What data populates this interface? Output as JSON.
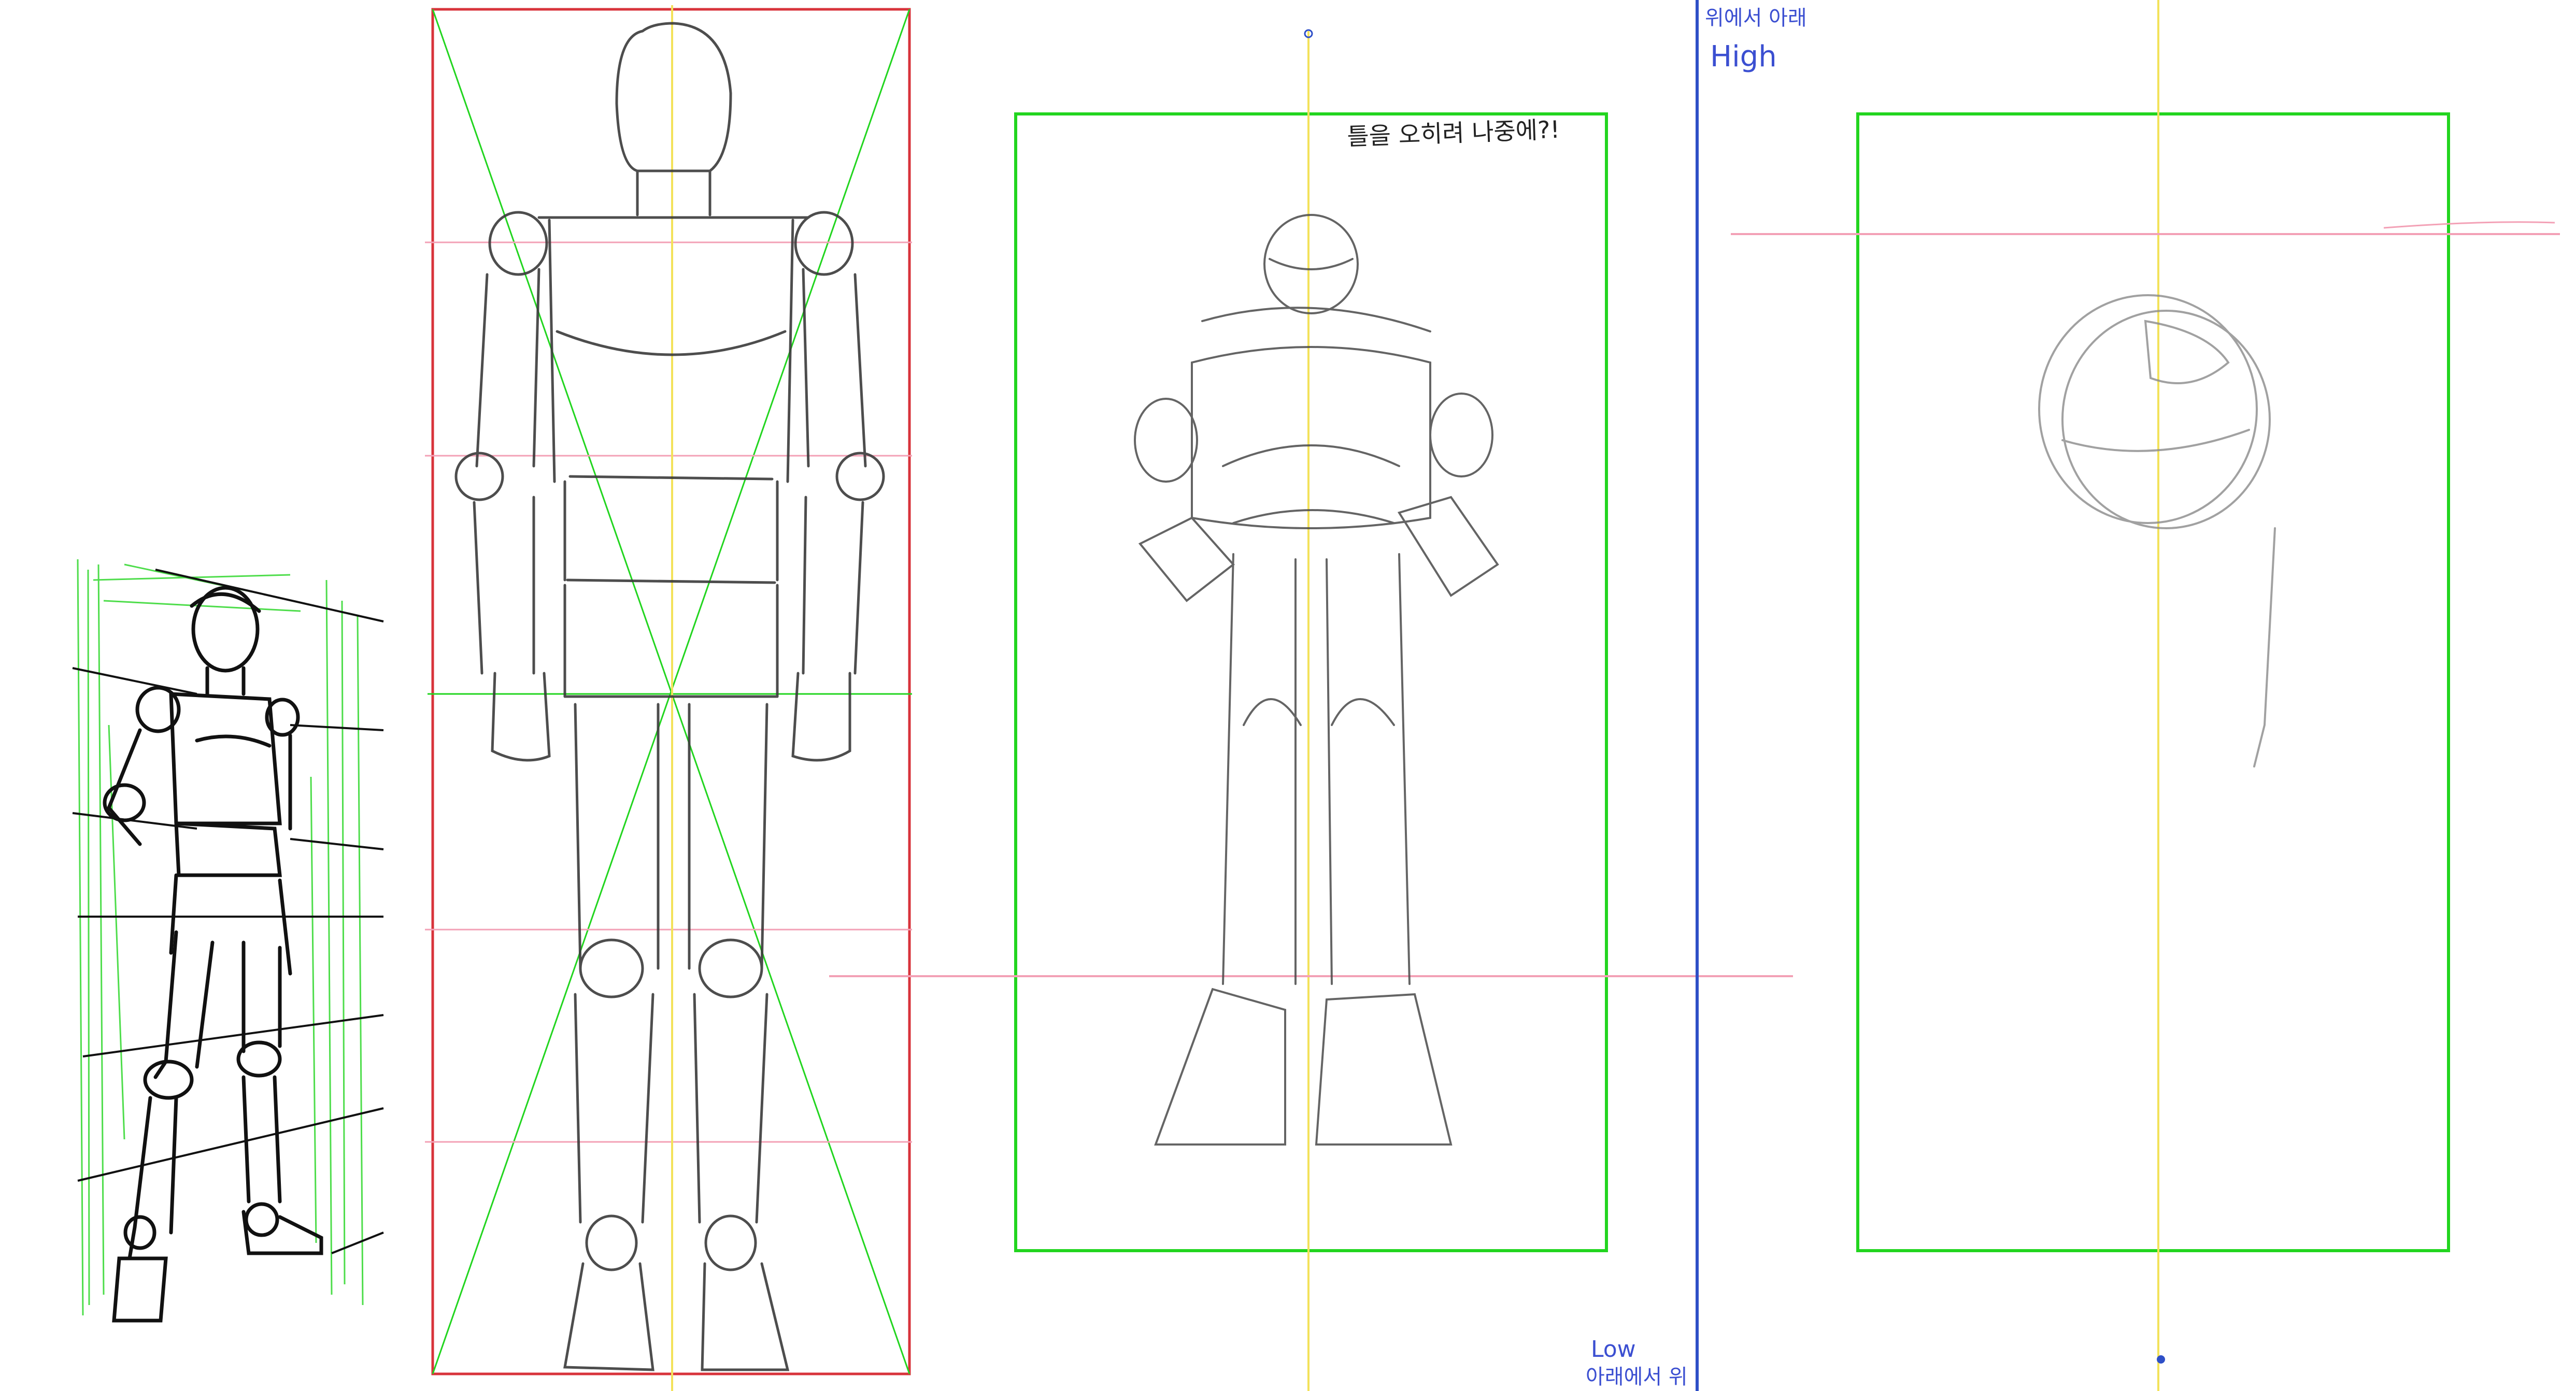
{
  "annotations": {
    "frame_note": "틀을 오히려 나중에?!",
    "top_to_bottom": "위에서 아래",
    "high": "High",
    "low": "Low",
    "bottom_to_top": "아래에서 위"
  },
  "colors": {
    "frame_green": "#22d51f",
    "frame_red": "#d8333b",
    "center_line": "#f3e25a",
    "guide_pink": "#f3a1b6",
    "divider_blue": "#2e4fc7",
    "pencil": "#3a3a3a"
  }
}
